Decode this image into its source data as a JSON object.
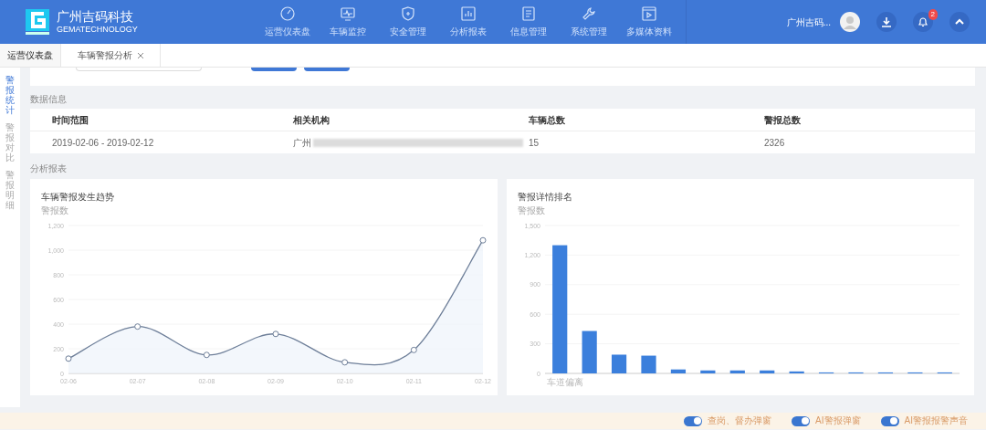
{
  "brand": {
    "name": "广州吉码科技",
    "subtitle": "GEMATECHNOLOGY"
  },
  "nav": [
    {
      "label": "运营仪表盘"
    },
    {
      "label": "车辆监控"
    },
    {
      "label": "安全管理"
    },
    {
      "label": "分析报表"
    },
    {
      "label": "信息管理"
    },
    {
      "label": "系统管理"
    },
    {
      "label": "多媒体资料"
    }
  ],
  "user": {
    "name": "广州吉码...",
    "notifications": "2"
  },
  "tabs": [
    {
      "label": "运营仪表盘",
      "selected": false,
      "closable": false
    },
    {
      "label": "车辆警报分析",
      "selected": true,
      "closable": true
    }
  ],
  "sidebar": [
    {
      "label": "警报统计",
      "selected": true
    },
    {
      "label": "警报对比",
      "selected": false
    },
    {
      "label": "警报明细",
      "selected": false
    }
  ],
  "data_section": {
    "title": "数据信息",
    "columns": [
      "时间范围",
      "相关机构",
      "车辆总数",
      "警报总数"
    ],
    "row": [
      "2019-02-06 - 2019-02-12",
      "广州",
      "15",
      "2326"
    ]
  },
  "report_section": {
    "title": "分析报表"
  },
  "trend_chart": {
    "chart_data": {
      "type": "area",
      "title": "车辆警报发生趋势",
      "ylabel": "警报数",
      "categories": [
        "02-06",
        "02-07",
        "02-08",
        "02-09",
        "02-10",
        "02-11",
        "02-12"
      ],
      "series": [
        {
          "color": "#6e7f99",
          "values": [
            120,
            380,
            150,
            320,
            90,
            190,
            1080
          ]
        }
      ],
      "grid": true,
      "ylim": [
        0,
        1200
      ],
      "yticks": [
        0,
        {
          "value": 200,
          "label": "200"
        },
        {
          "value": 400,
          "label": "400"
        },
        {
          "value": 600,
          "label": "600"
        },
        {
          "value": 800,
          "label": "800"
        },
        {
          "value": 1000,
          "label": "1,000"
        },
        {
          "value": 1200,
          "label": "1,200"
        }
      ]
    }
  },
  "ranking_chart": {
    "chart_data": {
      "type": "bar",
      "title": "警报详情排名",
      "ylabel": "警报数",
      "series": [
        {
          "color": "#3b7fdc",
          "values": [
            1300,
            430,
            190,
            180,
            40,
            30,
            30,
            30,
            20,
            10,
            10,
            10,
            10,
            10
          ]
        }
      ],
      "grid": true,
      "ylim": [
        0,
        1500
      ],
      "yticks": [
        0,
        {
          "value": 300,
          "label": "300"
        },
        {
          "value": 600,
          "label": "600"
        },
        {
          "value": 900,
          "label": "900"
        },
        {
          "value": 1200,
          "label": "1,200"
        },
        {
          "value": 1500,
          "label": "1,500"
        }
      ]
    },
    "first_bar_label": "车道偏离"
  },
  "toggles": [
    {
      "label": "查岗、督办弹窗",
      "on": true
    },
    {
      "label": "AI警报弹窗",
      "on": true
    },
    {
      "label": "AI警报报警声音",
      "on": true
    }
  ]
}
